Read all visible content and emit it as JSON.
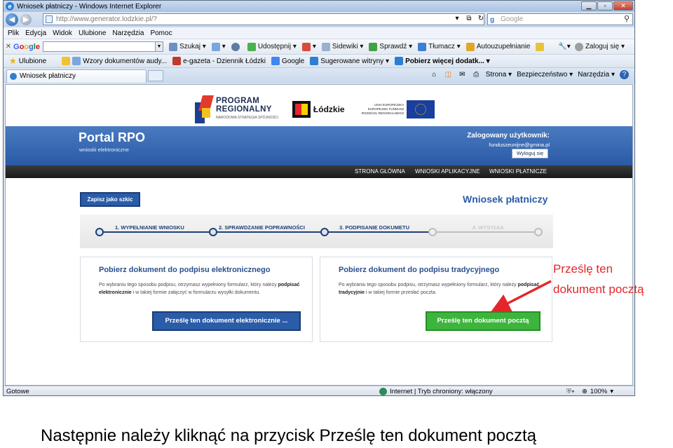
{
  "browser": {
    "window_title": "Wniosek płatniczy - Windows Internet Explorer",
    "url": "http://www.generator.lodzkie.pl/?",
    "search_placeholder": "Google",
    "menu": [
      "Plik",
      "Edycja",
      "Widok",
      "Ulubione",
      "Narzędzia",
      "Pomoc"
    ],
    "google_toolbar": {
      "logo": "Google",
      "items": [
        "Szukaj",
        "Udostępnij",
        "Sidewiki",
        "Sprawdź",
        "Tłumacz",
        "Autouzupełnianie"
      ],
      "signin": "Zaloguj się"
    },
    "favorites": {
      "label": "Ulubione",
      "items": [
        "Wzory dokumentów audy...",
        "e-gazeta - Dziennik Łódzki",
        "Google",
        "Sugerowane witryny",
        "Pobierz więcej dodatk..."
      ]
    },
    "tab_title": "Wniosek płatniczy",
    "command_bar": [
      "Strona",
      "Bezpieczeństwo",
      "Narzędzia"
    ],
    "status": {
      "left": "Gotowe",
      "zone": "Internet | Tryb chroniony: włączony",
      "zoom": "100%"
    }
  },
  "page": {
    "logos": {
      "program_line1": "PROGRAM",
      "program_line2": "REGIONALNY",
      "program_sub": "NARODOWA STRATEGIA SPÓJNOŚCI",
      "region": "Łódzkie",
      "eu_text": "UNIA EUROPEJSKA\nEUROPEJSKI FUNDUSZ\nROZWOJU REGIONALNEGO"
    },
    "portal_title": "Portal RPO",
    "portal_subtitle": "wnioski elektroniczne",
    "logged_label": "Zalogowany użytkownik:",
    "logged_email": "funduszeunijne@gmina.pl",
    "logout": "Wyloguj się",
    "nav": [
      "STRONA GŁÓWNA",
      "WNIOSKI APLIKACYJNE",
      "WNIOSKI PŁATNICZE"
    ],
    "save_draft": "Zapisz jako szkic",
    "heading": "Wniosek płatniczy",
    "steps": [
      "1. WYPEŁNIANIE WNIOSKU",
      "2. SPRAWDZANIE POPRAWNOŚCI",
      "3. PODPISANIE DOKUMETU",
      "4. WYSYŁKA"
    ],
    "panel_electronic": {
      "title": "Pobierz dokument do podpisu elektronicznego",
      "text_a": "Po wybraniu tego sposobu podpisu, otrzymasz wypełniony formularz, który należy ",
      "text_b": "podpisać elektronicznie",
      "text_c": " i w takiej formie załączyć w formularzu wysyłki dokumentu.",
      "button": "Prześlę ten dokument elektronicznie ..."
    },
    "panel_traditional": {
      "title": "Pobierz dokument do podpisu tradycyjnego",
      "text_a": "Po wybraniu tego sposobu podpisu, otrzymasz wypełniony formularz, który należy ",
      "text_b": "podpisać tradycyjnie",
      "text_c": " i w takiej formie przesłać poczta.",
      "button": "Prześlę ten dokument pocztą"
    }
  },
  "annotation": {
    "line1": "Prześlę ten",
    "line2": "dokument pocztą",
    "color": "#e3262a"
  },
  "caption": "Następnie należy kliknąć na przycisk Prześlę ten dokument pocztą"
}
